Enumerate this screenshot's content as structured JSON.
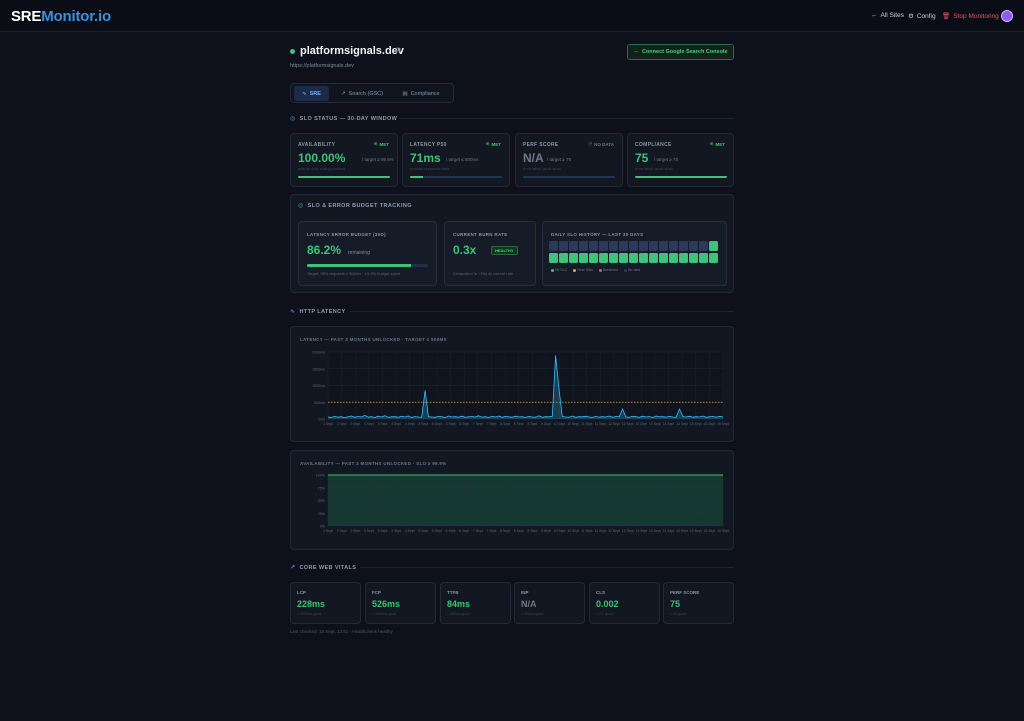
{
  "brand": {
    "part1": "SRE",
    "part2": "Monitor.io"
  },
  "nav": {
    "all_sites": "All Sites",
    "config": "Config",
    "stop": "Stop Monitoring"
  },
  "site": {
    "name": "platformsignals.dev",
    "url": "https://platformsignals.dev"
  },
  "gsc_button": "Connect Google Search Console",
  "tabs": [
    {
      "label": "SRE",
      "icon": "pulse-icon"
    },
    {
      "label": "Search (GSC)",
      "icon": "trend-icon"
    },
    {
      "label": "Compliance",
      "icon": "document-icon"
    }
  ],
  "slo_status": {
    "title": "SLO STATUS — 30-DAY WINDOW",
    "cards": [
      {
        "label": "AVAILABILITY",
        "badge": "MET",
        "value": "100.00%",
        "target": "/ target ≥ 99.9%",
        "sub": "uptime over rolling window",
        "progress": 1.0,
        "met": true
      },
      {
        "label": "LATENCY P50",
        "badge": "MET",
        "value": "71ms",
        "target": "/ target ≤ 500ms",
        "sub": "median response time",
        "progress": 0.14,
        "met": true
      },
      {
        "label": "PERF SCORE",
        "badge": "NO DATA",
        "value": "N/A",
        "target": "/ target ≥ 75",
        "sub": "from latest audit scan",
        "progress": 0,
        "met": false
      },
      {
        "label": "COMPLIANCE",
        "badge": "MET",
        "value": "75",
        "target": "/ target ≥ 75",
        "sub": "from latest audit scan",
        "progress": 1.0,
        "met": true
      }
    ]
  },
  "error_budget": {
    "title": "SLO & ERROR BUDGET TRACKING",
    "latency_budget": {
      "label": "LATENCY ERROR BUDGET (30D)",
      "value": "86.2%",
      "suffix": "remaining",
      "remaining": 0.862,
      "note": "Target: 95% requests ≤ 500ms · 13.8% budget spent"
    },
    "burn_rate": {
      "label": "CURRENT BURN RATE",
      "value": "0.3x",
      "status": "HEALTHY",
      "note": "Exhaustion in ~90d at current rate"
    },
    "history": {
      "label": "DAILY SLO HISTORY — LAST 30 DAYS",
      "legend": [
        "Hit SLO",
        "Near Miss",
        "Breached",
        "No data"
      ],
      "days": [
        "nodata",
        "nodata",
        "nodata",
        "nodata",
        "nodata",
        "nodata",
        "nodata",
        "nodata",
        "nodata",
        "nodata",
        "nodata",
        "nodata",
        "nodata",
        "nodata",
        "nodata",
        "nodata",
        "hit",
        "hit",
        "hit",
        "hit",
        "hit",
        "hit",
        "hit",
        "hit",
        "hit",
        "hit",
        "hit",
        "hit",
        "hit",
        "hit",
        "hit",
        "hit",
        "hit",
        "hit"
      ]
    }
  },
  "http_latency": {
    "title": "HTTP LATENCY",
    "latency_chart": {
      "label": "LATENCY — PAST 3 MONTHS UNLOCKED · TARGET ≤ 500MS",
      "y_ticks": [
        "2000ms",
        "1500ms",
        "1000ms",
        "500ms",
        "0ms"
      ],
      "x_ticks": [
        "1 Sept",
        "2 Sept",
        "2 Sept",
        "3 Sept",
        "3 Sept",
        "4 Sept",
        "4 Sept",
        "5 Sept",
        "5 Sept",
        "6 Sept",
        "6 Sept",
        "7 Sept",
        "7 Sept",
        "8 Sept",
        "8 Sept",
        "9 Sept",
        "9 Sept",
        "10 Sept",
        "10 Sept",
        "11 Sept",
        "11 Sept",
        "12 Sept",
        "12 Sept",
        "13 Sept",
        "13 Sept",
        "14 Sept",
        "14 Sept",
        "15 Sept",
        "15 Sept",
        "16 Sept"
      ]
    },
    "availability_chart": {
      "label": "AVAILABILITY — PAST 3 MONTHS UNLOCKED · SLO ≥ 99.9%",
      "y_ticks": [
        "100%",
        "75%",
        "50%",
        "25%",
        "0%"
      ],
      "x_ticks": [
        "1 Sept",
        "2 Sept",
        "2 Sept",
        "3 Sept",
        "3 Sept",
        "4 Sept",
        "4 Sept",
        "5 Sept",
        "5 Sept",
        "6 Sept",
        "6 Sept",
        "7 Sept",
        "7 Sept",
        "8 Sept",
        "8 Sept",
        "9 Sept",
        "9 Sept",
        "10 Sept",
        "10 Sept",
        "11 Sept",
        "11 Sept",
        "12 Sept",
        "12 Sept",
        "13 Sept",
        "13 Sept",
        "14 Sept",
        "14 Sept",
        "15 Sept",
        "15 Sept",
        "16 Sept"
      ]
    }
  },
  "chart_data": [
    {
      "type": "line",
      "title": "LATENCY — PAST 3 MONTHS UNLOCKED · TARGET ≤ 500MS",
      "ylim": [
        0,
        2000
      ],
      "threshold": 500,
      "x_range": [
        "1 Sept",
        "16 Sept"
      ],
      "series": [
        {
          "name": "",
          "values": [
            60,
            45,
            80,
            55,
            70,
            40,
            65,
            90,
            50,
            75,
            60,
            110,
            55,
            70,
            45,
            85,
            60,
            100,
            50,
            65,
            70,
            55,
            80,
            60,
            90,
            45,
            75,
            60,
            55,
            850,
            70,
            60,
            50,
            80,
            65,
            45,
            90,
            60,
            70,
            55,
            85,
            50,
            65,
            75,
            60,
            100,
            55,
            70,
            45,
            80,
            60,
            90,
            50,
            75,
            65,
            55,
            85,
            60,
            70,
            45,
            80,
            60,
            55,
            95,
            50,
            70,
            65,
            80,
            1900,
            900,
            75,
            60,
            55,
            90,
            50,
            70,
            65,
            85,
            60,
            45,
            80,
            55,
            70,
            60,
            90,
            50,
            75,
            65,
            300,
            60,
            55,
            80,
            70,
            50,
            85,
            60,
            75,
            45,
            90,
            65,
            70,
            55,
            80,
            60,
            50,
            300,
            75,
            60,
            85,
            55,
            70,
            60,
            90,
            50,
            65,
            75,
            55,
            80,
            60
          ]
        }
      ]
    },
    {
      "type": "area",
      "title": "AVAILABILITY — PAST 3 MONTHS UNLOCKED · SLO ≥ 99.9%",
      "ylim": [
        0,
        100
      ],
      "x_range": [
        "1 Sept",
        "16 Sept"
      ],
      "series": [
        {
          "name": "",
          "values": [
            100,
            100,
            100,
            100,
            100,
            100,
            100,
            100,
            100,
            100,
            100,
            100,
            100,
            100,
            100,
            100
          ]
        }
      ]
    }
  ],
  "core_web_vitals": {
    "title": "CORE WEB VITALS",
    "cards": [
      {
        "label": "LCP",
        "value": "228ms",
        "sub": "< 2500ms good",
        "good": true
      },
      {
        "label": "FCP",
        "value": "526ms",
        "sub": "< 1800ms good",
        "good": true
      },
      {
        "label": "TTFB",
        "value": "84ms",
        "sub": "< 800ms good",
        "good": true
      },
      {
        "label": "INP",
        "value": "N/A",
        "sub": "< 200ms good",
        "good": false
      },
      {
        "label": "CLS",
        "value": "0.002",
        "sub": "< 0.1 good",
        "good": true
      },
      {
        "label": "PERF SCORE",
        "value": "75",
        "sub": "≥ 90 good",
        "good": true
      }
    ]
  },
  "footer": "Last checked: 16 Sept, 13:51 · Healthcheck healthy"
}
